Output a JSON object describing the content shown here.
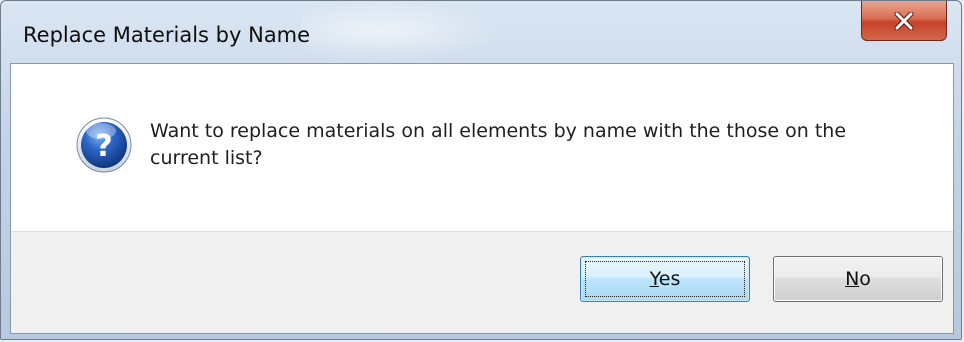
{
  "window": {
    "title": "Replace Materials by Name"
  },
  "dialog": {
    "icon": "question-icon",
    "message": "Want to replace materials on all elements by name with the those on the current list?"
  },
  "buttons": {
    "yes": {
      "mnemonic": "Y",
      "rest": "es"
    },
    "no": {
      "mnemonic": "N",
      "rest": "o"
    }
  },
  "colors": {
    "close_button": "#c7412a",
    "default_button_border": "#3c7fb1",
    "icon_blue": "#1b4fa6"
  }
}
